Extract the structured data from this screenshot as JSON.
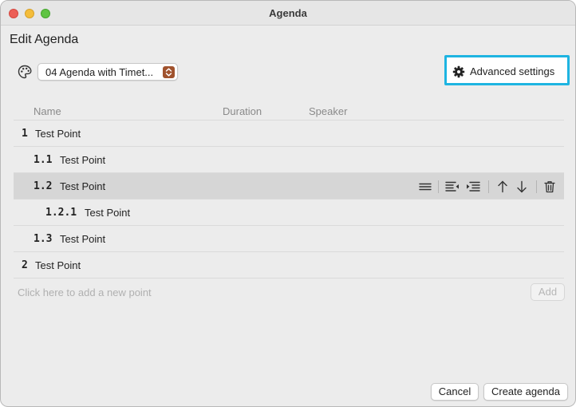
{
  "window": {
    "title": "Agenda"
  },
  "heading": "Edit Agenda",
  "template": {
    "selected": "04 Agenda with Timet...",
    "icon": "palette-icon"
  },
  "advanced_button": {
    "label": "Advanced settings",
    "icon": "gear-icon",
    "highlight_color": "#1eb4e1"
  },
  "columns": [
    "Name",
    "Duration",
    "Speaker"
  ],
  "rows": [
    {
      "num": "1",
      "title": "Test Point",
      "level": 0,
      "selected": false
    },
    {
      "num": "1.1",
      "title": "Test Point",
      "level": 1,
      "selected": false
    },
    {
      "num": "1.2",
      "title": "Test Point",
      "level": 1,
      "selected": true
    },
    {
      "num": "1.2.1",
      "title": "Test Point",
      "level": 2,
      "selected": false
    },
    {
      "num": "1.3",
      "title": "Test Point",
      "level": 1,
      "selected": false
    },
    {
      "num": "2",
      "title": "Test Point",
      "level": 0,
      "selected": false
    }
  ],
  "row_tools": [
    "drag-handle-icon",
    "outdent-icon",
    "indent-icon",
    "move-up-icon",
    "move-down-icon",
    "trash-icon"
  ],
  "new_point": {
    "placeholder": "Click here to add a new point",
    "add_label": "Add"
  },
  "footer": {
    "cancel_label": "Cancel",
    "create_label": "Create agenda"
  }
}
